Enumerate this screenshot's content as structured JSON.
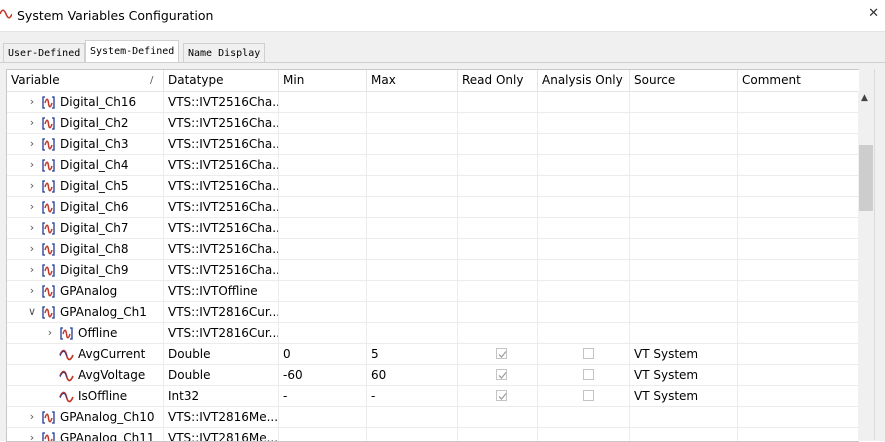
{
  "window": {
    "title": "System Variables Configuration",
    "close_icon": "close-icon"
  },
  "tabs": [
    {
      "label": "User-Defined",
      "active": false
    },
    {
      "label": "System-Defined",
      "active": true
    },
    {
      "label": "Name Display",
      "active": false
    }
  ],
  "columns": {
    "variable": "Variable",
    "sort_indicator": "/",
    "datatype": "Datatype",
    "min": "Min",
    "max": "Max",
    "read_only": "Read Only",
    "analysis_only": "Analysis Only",
    "source": "Source",
    "comment": "Comment"
  },
  "rows": [
    {
      "level": 1,
      "expand": "collapsed",
      "icon": "namespace-icon",
      "name": "Digital_Ch16",
      "datatype": "VTS::IVT2516Cha...",
      "min": "",
      "max": "",
      "read_only": null,
      "analysis_only": null,
      "source": "",
      "comment": ""
    },
    {
      "level": 1,
      "expand": "collapsed",
      "icon": "namespace-icon",
      "name": "Digital_Ch2",
      "datatype": "VTS::IVT2516Cha...",
      "min": "",
      "max": "",
      "read_only": null,
      "analysis_only": null,
      "source": "",
      "comment": ""
    },
    {
      "level": 1,
      "expand": "collapsed",
      "icon": "namespace-icon",
      "name": "Digital_Ch3",
      "datatype": "VTS::IVT2516Cha...",
      "min": "",
      "max": "",
      "read_only": null,
      "analysis_only": null,
      "source": "",
      "comment": ""
    },
    {
      "level": 1,
      "expand": "collapsed",
      "icon": "namespace-icon",
      "name": "Digital_Ch4",
      "datatype": "VTS::IVT2516Cha...",
      "min": "",
      "max": "",
      "read_only": null,
      "analysis_only": null,
      "source": "",
      "comment": ""
    },
    {
      "level": 1,
      "expand": "collapsed",
      "icon": "namespace-icon",
      "name": "Digital_Ch5",
      "datatype": "VTS::IVT2516Cha...",
      "min": "",
      "max": "",
      "read_only": null,
      "analysis_only": null,
      "source": "",
      "comment": ""
    },
    {
      "level": 1,
      "expand": "collapsed",
      "icon": "namespace-icon",
      "name": "Digital_Ch6",
      "datatype": "VTS::IVT2516Cha...",
      "min": "",
      "max": "",
      "read_only": null,
      "analysis_only": null,
      "source": "",
      "comment": ""
    },
    {
      "level": 1,
      "expand": "collapsed",
      "icon": "namespace-icon",
      "name": "Digital_Ch7",
      "datatype": "VTS::IVT2516Cha...",
      "min": "",
      "max": "",
      "read_only": null,
      "analysis_only": null,
      "source": "",
      "comment": ""
    },
    {
      "level": 1,
      "expand": "collapsed",
      "icon": "namespace-icon",
      "name": "Digital_Ch8",
      "datatype": "VTS::IVT2516Cha...",
      "min": "",
      "max": "",
      "read_only": null,
      "analysis_only": null,
      "source": "",
      "comment": ""
    },
    {
      "level": 1,
      "expand": "collapsed",
      "icon": "namespace-icon",
      "name": "Digital_Ch9",
      "datatype": "VTS::IVT2516Cha...",
      "min": "",
      "max": "",
      "read_only": null,
      "analysis_only": null,
      "source": "",
      "comment": ""
    },
    {
      "level": 1,
      "expand": "collapsed",
      "icon": "namespace-icon",
      "name": "GPAnalog",
      "datatype": "VTS::IVTOffline",
      "min": "",
      "max": "",
      "read_only": null,
      "analysis_only": null,
      "source": "",
      "comment": ""
    },
    {
      "level": 1,
      "expand": "expanded",
      "icon": "namespace-icon",
      "name": "GPAnalog_Ch1",
      "datatype": "VTS::IVT2816Cur...",
      "min": "",
      "max": "",
      "read_only": null,
      "analysis_only": null,
      "source": "",
      "comment": ""
    },
    {
      "level": 2,
      "expand": "collapsed",
      "icon": "namespace-icon",
      "name": "Offline",
      "datatype": "VTS::IVT2816Cur...",
      "min": "",
      "max": "",
      "read_only": null,
      "analysis_only": null,
      "source": "",
      "comment": ""
    },
    {
      "level": 2,
      "expand": "none",
      "icon": "variable-icon",
      "name": "AvgCurrent",
      "datatype": "Double",
      "min": "0",
      "max": "5",
      "read_only": true,
      "analysis_only": false,
      "source": "VT System",
      "comment": ""
    },
    {
      "level": 2,
      "expand": "none",
      "icon": "variable-icon",
      "name": "AvgVoltage",
      "datatype": "Double",
      "min": "-60",
      "max": "60",
      "read_only": true,
      "analysis_only": false,
      "source": "VT System",
      "comment": ""
    },
    {
      "level": 2,
      "expand": "none",
      "icon": "variable-icon",
      "name": "IsOffline",
      "datatype": "Int32",
      "min": "-",
      "max": "-",
      "read_only": true,
      "analysis_only": false,
      "source": "VT System",
      "comment": ""
    },
    {
      "level": 1,
      "expand": "collapsed",
      "icon": "namespace-icon",
      "name": "GPAnalog_Ch10",
      "datatype": "VTS::IVT2816Me...",
      "min": "",
      "max": "",
      "read_only": null,
      "analysis_only": null,
      "source": "",
      "comment": ""
    },
    {
      "level": 1,
      "expand": "collapsed",
      "icon": "namespace-icon",
      "name": "GPAnalog_Ch11",
      "datatype": "VTS::IVT2816Me...",
      "min": "",
      "max": "",
      "read_only": null,
      "analysis_only": null,
      "source": "",
      "comment": ""
    }
  ],
  "colors": {
    "tab_bg": "#f0f0f0",
    "grid_line": "#ececec",
    "icon_red": "#c0392b",
    "icon_blue": "#1f3a93"
  }
}
